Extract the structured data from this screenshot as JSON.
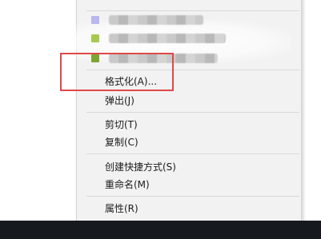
{
  "context_menu": {
    "items": [
      {
        "label": "格式化(A)...",
        "group": "format"
      },
      {
        "label": "弹出(J)",
        "group": "format"
      },
      {
        "label": "剪切(T)",
        "group": "clipboard"
      },
      {
        "label": "复制(C)",
        "group": "clipboard"
      },
      {
        "label": "创建快捷方式(S)",
        "group": "manage"
      },
      {
        "label": "重命名(M)",
        "group": "manage"
      },
      {
        "label": "属性(R)",
        "group": "properties"
      }
    ]
  },
  "annotation": {
    "color": "#e04848"
  },
  "colors": {
    "menu_bg": "#f2f2f2",
    "taskbar": "#16191d",
    "separator": "#d8d8d8"
  }
}
